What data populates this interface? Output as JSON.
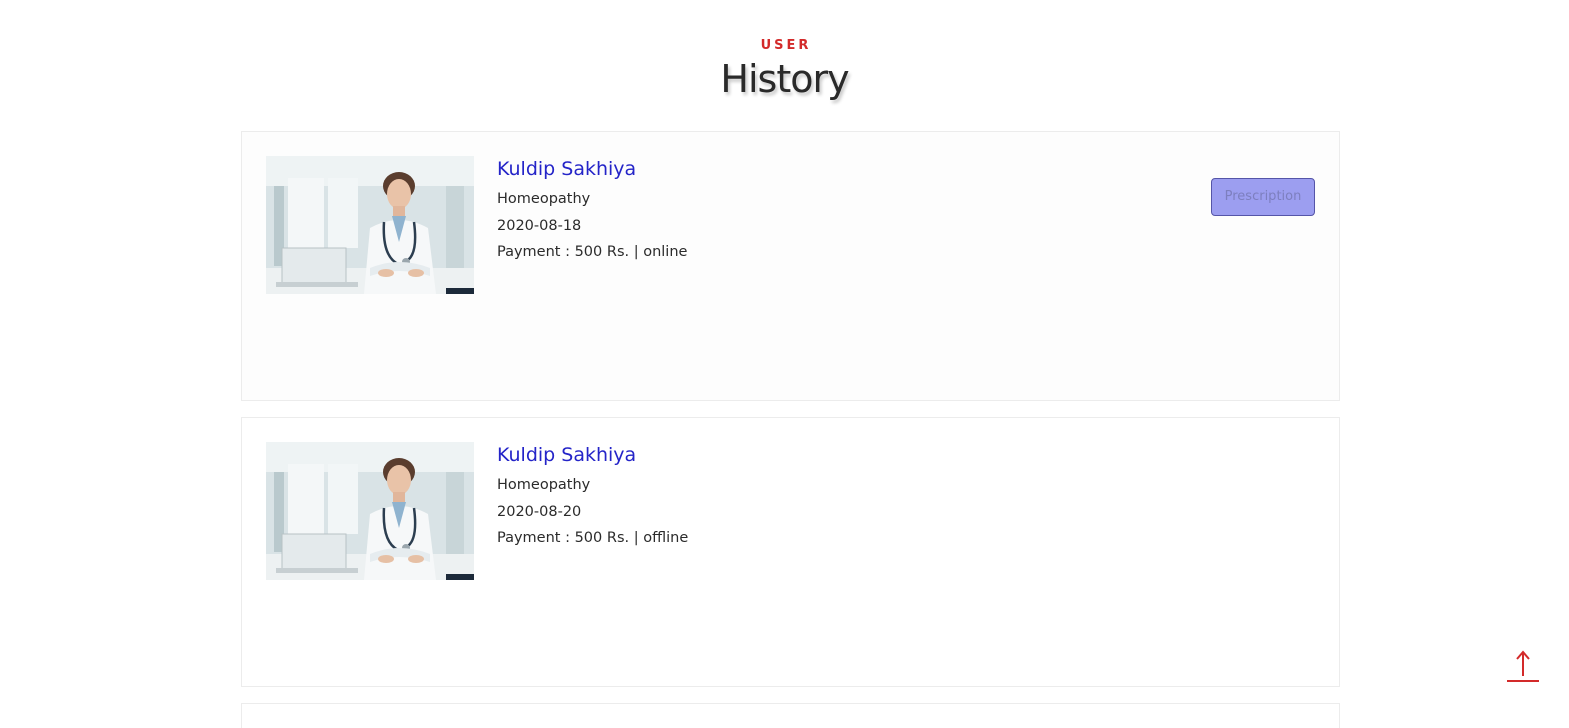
{
  "section": {
    "eyebrow": "USER",
    "title": "History"
  },
  "appointments": [
    {
      "doctor_name": "Kuldip Sakhiya",
      "specialty": "Homeopathy",
      "date": "2020-08-18",
      "payment": "Payment : 500 Rs. | online",
      "prescription_label": "Prescription"
    },
    {
      "doctor_name": "Kuldip Sakhiya",
      "specialty": "Homeopathy",
      "date": "2020-08-20",
      "payment": "Payment : 500 Rs. | offline"
    }
  ],
  "colors": {
    "accent_red": "#d32a2a",
    "doctor_name_blue": "#2424c8",
    "prescription_button": "#9c9ef0"
  },
  "icons": {
    "scroll_top": "arrow-up-icon"
  }
}
